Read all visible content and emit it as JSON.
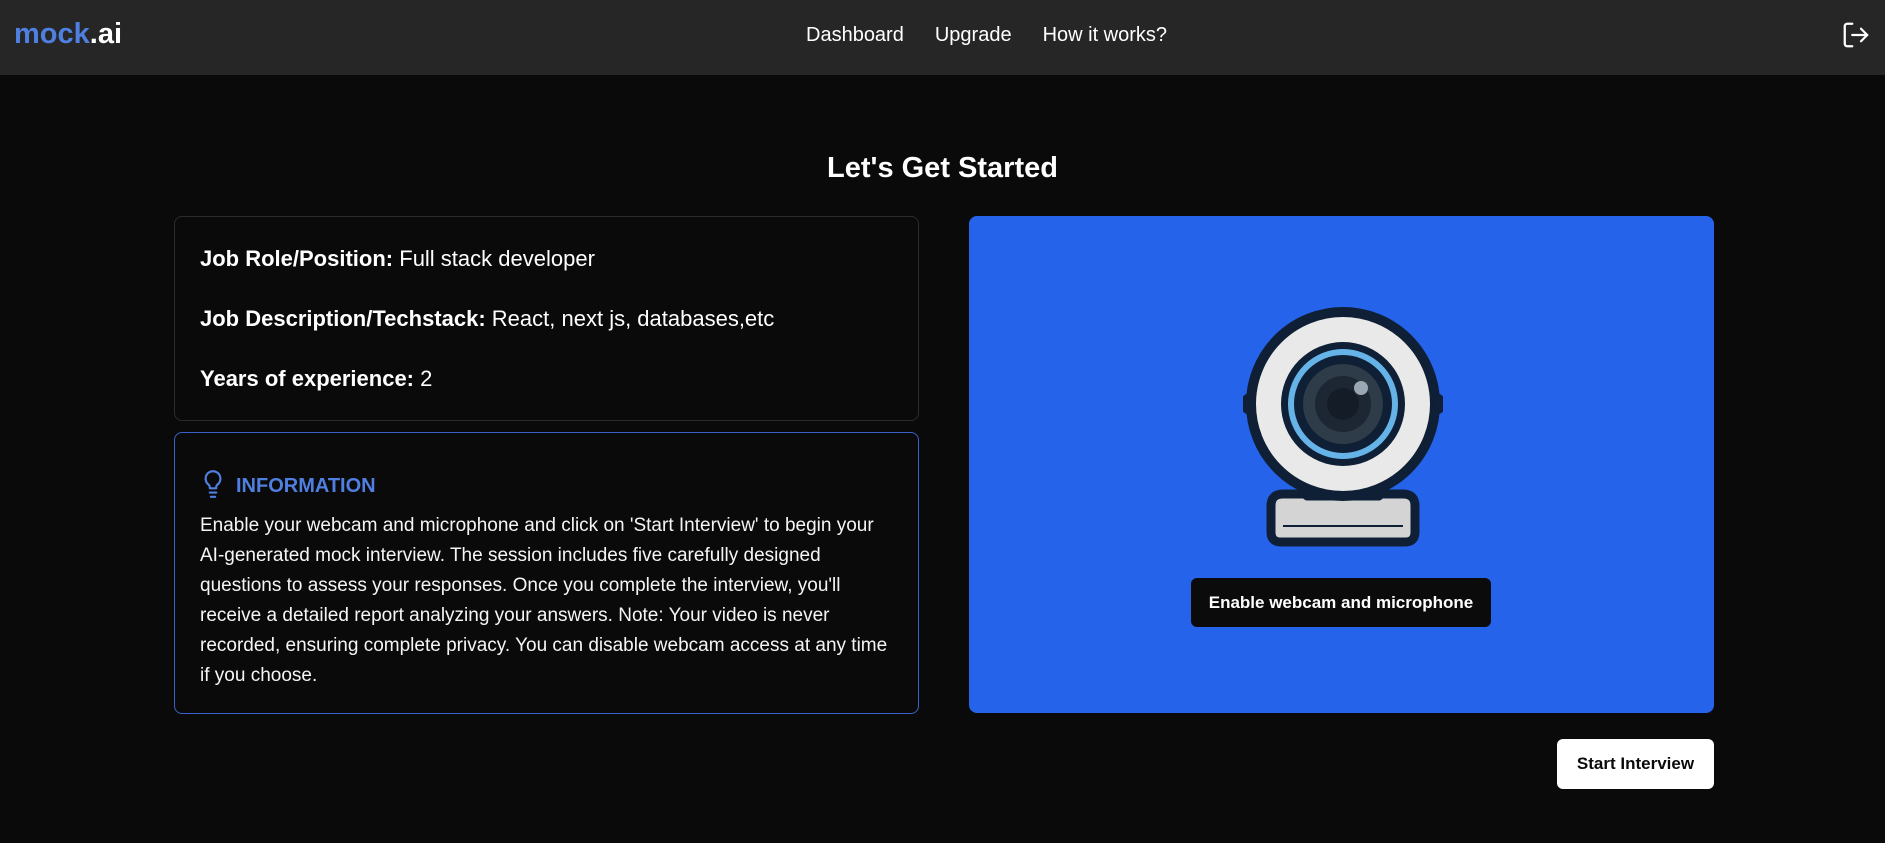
{
  "header": {
    "logo_brand": "mock",
    "logo_tld": ".ai",
    "nav": [
      {
        "label": "Dashboard"
      },
      {
        "label": "Upgrade"
      },
      {
        "label": "How it works?"
      }
    ],
    "logout_icon": "logout-icon"
  },
  "main": {
    "title": "Let's Get Started",
    "job": {
      "role_label": "Job Role/Position:",
      "role_value": "Full stack developer",
      "desc_label": "Job Description/Techstack:",
      "desc_value": "React, next js, databases,etc",
      "exp_label": "Years of experience:",
      "exp_value": "2"
    },
    "info": {
      "icon": "lightbulb-icon",
      "title": "INFORMATION",
      "text": "Enable your webcam and microphone and click on 'Start Interview' to begin your AI-generated mock interview. The session includes five carefully designed questions to assess your responses. Once you complete the interview, you'll receive a detailed report analyzing your answers. Note: Your video is never recorded, ensuring complete privacy. You can disable webcam access at any time if you choose."
    },
    "webcam": {
      "icon": "webcam-icon",
      "enable_label": "Enable webcam and microphone"
    },
    "start_label": "Start Interview"
  },
  "colors": {
    "background": "#0a0a0a",
    "header": "#262626",
    "accent": "#2563eb",
    "brand": "#4f7fe0"
  }
}
